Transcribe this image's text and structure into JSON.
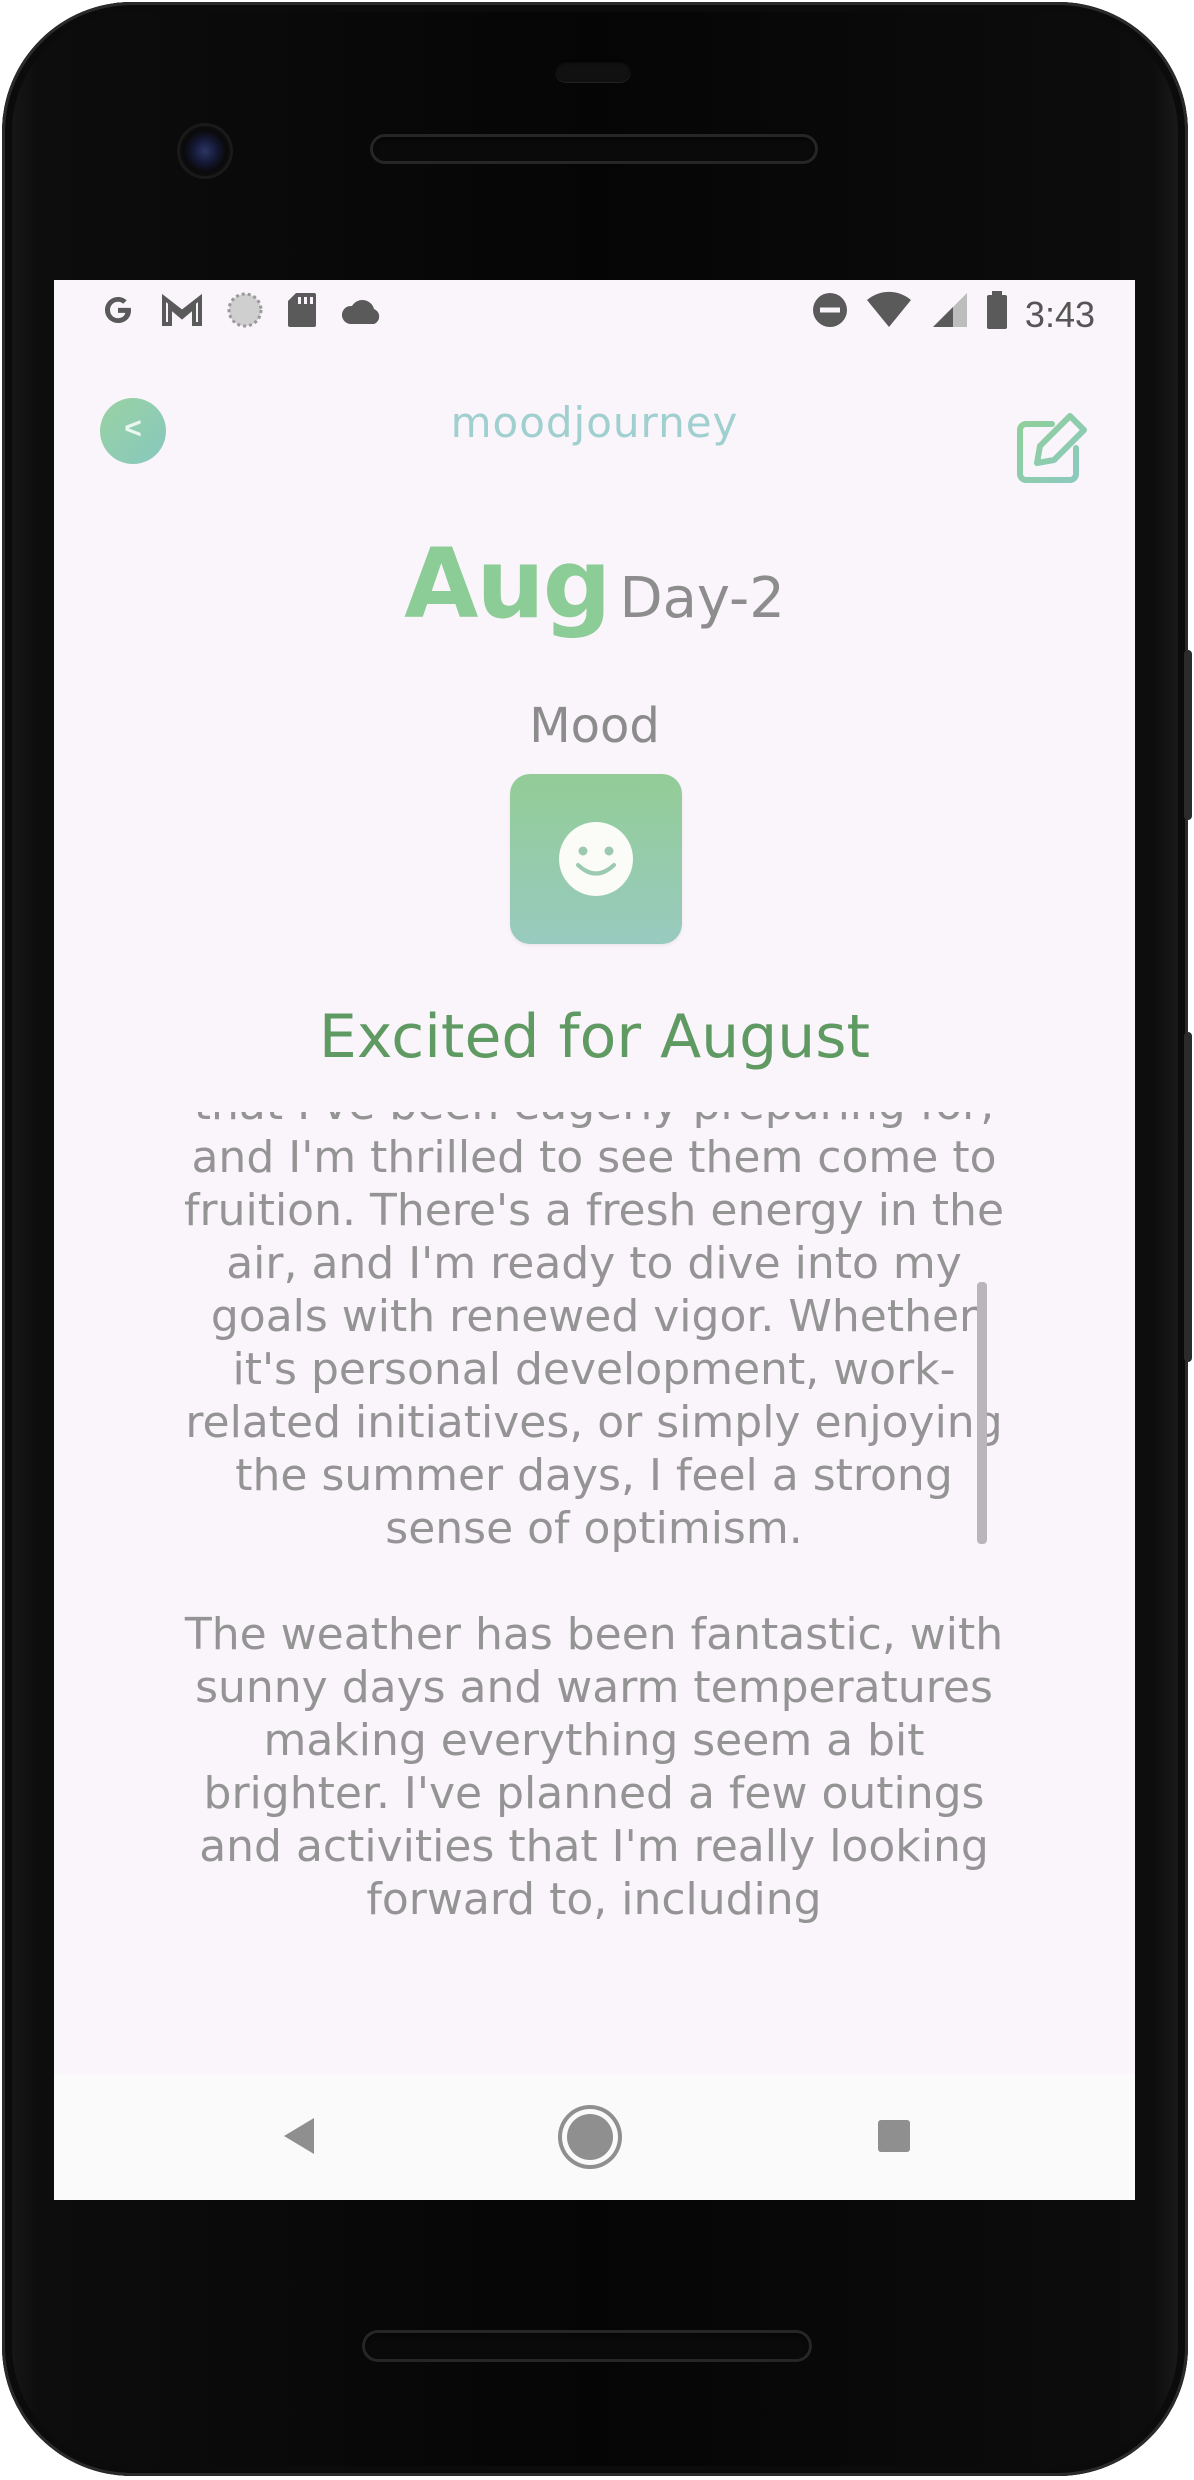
{
  "status_bar": {
    "left_icons": [
      "google-icon",
      "gmail-icon",
      "sync-icon",
      "sd-card-icon",
      "cloud-icon"
    ],
    "right_icons": [
      "do-not-disturb-icon",
      "wifi-icon",
      "signal-icon",
      "battery-icon"
    ],
    "time": "3:43"
  },
  "header": {
    "back_label": "<",
    "brand": "moodjourney",
    "edit_icon": "edit-icon"
  },
  "entry": {
    "month": "Aug",
    "day": "Day-2",
    "mood_label": "Mood",
    "mood_icon": "smiley-icon",
    "title": "Excited for August",
    "paragraphs": [
      "that I've been eagerly preparing for, and I'm thrilled to see them come to fruition. There's a fresh energy in the air, and I'm ready to dive into my goals with renewed vigor. Whether it's personal development, work-related initiatives, or simply enjoying the summer days, I feel a strong sense of optimism.",
      "The weather has been fantastic, with sunny days and warm temperatures making everything seem a bit brighter. I've planned a few outings and activities that I'm really looking forward to, including"
    ]
  },
  "nav_bar": {
    "icons": [
      "nav-back-icon",
      "nav-home-icon",
      "nav-recents-icon"
    ]
  },
  "colors": {
    "accent_green": "#8ccc96",
    "title_green": "#5f9a63",
    "brand_teal": "#9fd0cf",
    "background": "#faf4fb",
    "text_gray": "#949494"
  }
}
